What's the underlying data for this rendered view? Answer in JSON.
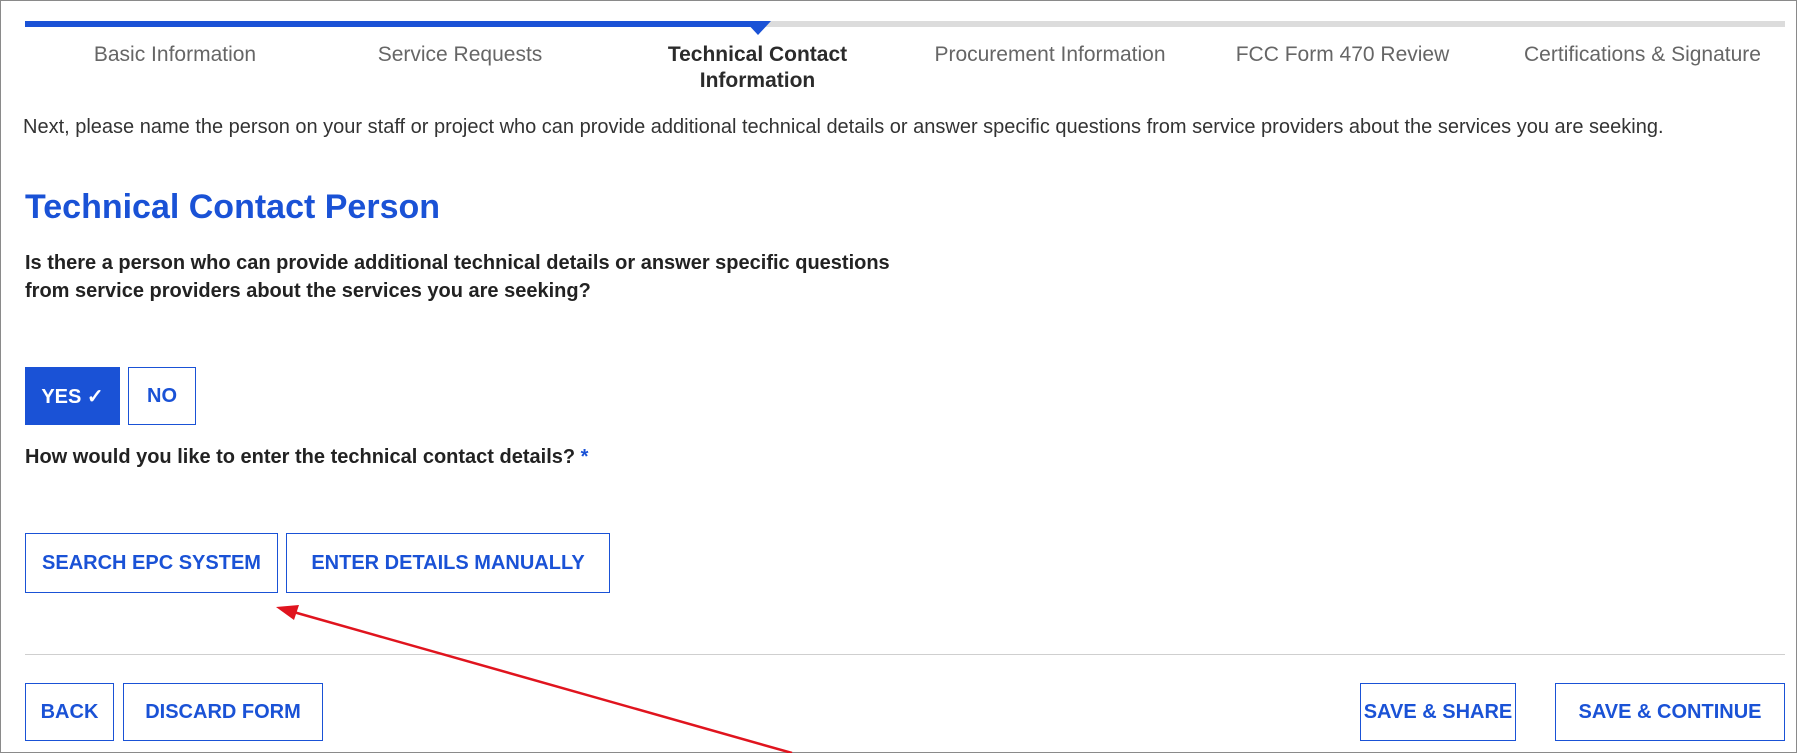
{
  "steps": [
    {
      "label": "Basic Information"
    },
    {
      "label": "Service Requests"
    },
    {
      "label": "Technical Contact Information"
    },
    {
      "label": "Procurement Information"
    },
    {
      "label": "FCC Form 470 Review"
    },
    {
      "label": "Certifications & Signature"
    }
  ],
  "progress": {
    "current_step": 3,
    "total_steps": 6
  },
  "intro_text": "Next, please name the person on your staff or project who can provide additional technical details or answer specific questions from service providers about the services you are seeking.",
  "section_title": "Technical Contact Person",
  "question1": "Is there a person who can provide additional technical details or answer specific questions from service providers about the services you are seeking?",
  "yes_label": "YES ✓",
  "no_label": "NO",
  "yes_selected": true,
  "question2": "How would you like to enter the technical contact details?",
  "required_marker": "*",
  "search_epc_label": "SEARCH EPC SYSTEM",
  "enter_manually_label": "ENTER DETAILS MANUALLY",
  "footer": {
    "back_label": "BACK",
    "discard_label": "DISCARD FORM",
    "save_share_label": "SAVE & SHARE",
    "save_continue_label": "SAVE & CONTINUE"
  },
  "colors": {
    "accent": "#1a52d6",
    "annotation_arrow": "#e0141e"
  }
}
